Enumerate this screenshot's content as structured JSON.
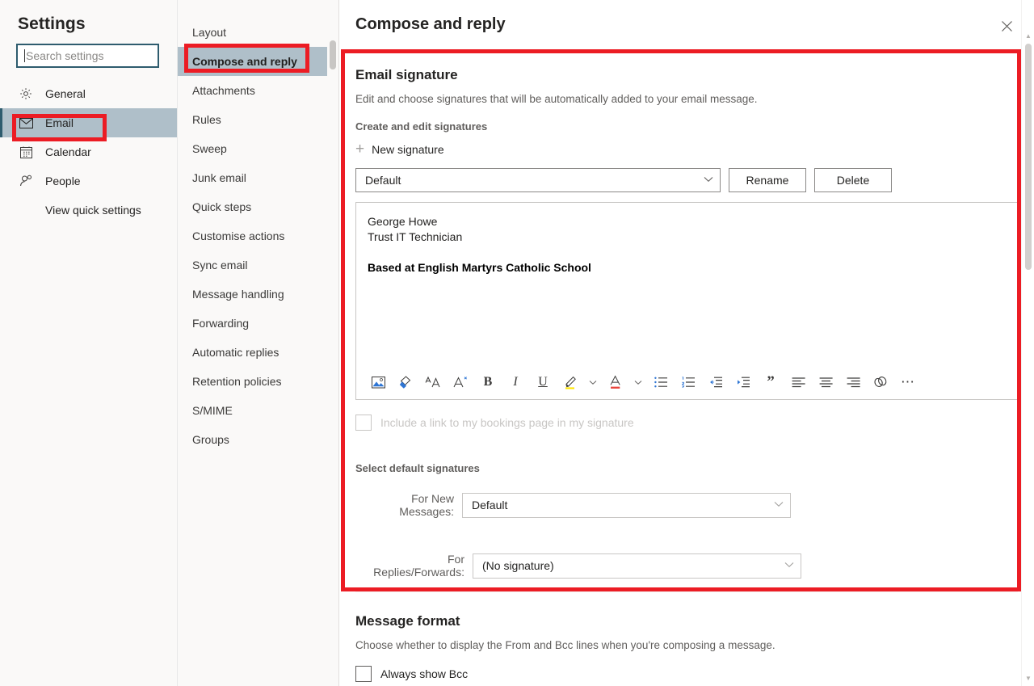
{
  "sidebar": {
    "title": "Settings",
    "search": {
      "placeholder": "Search settings",
      "value": ""
    },
    "items": [
      {
        "label": "General",
        "icon": "gear-icon"
      },
      {
        "label": "Email",
        "icon": "envelope-icon"
      },
      {
        "label": "Calendar",
        "icon": "calendar-icon"
      },
      {
        "label": "People",
        "icon": "person-icon"
      }
    ],
    "quick_settings_link": "View quick settings"
  },
  "midcol": {
    "items": [
      "Layout",
      "Compose and reply",
      "Attachments",
      "Rules",
      "Sweep",
      "Junk email",
      "Quick steps",
      "Customise actions",
      "Sync email",
      "Message handling",
      "Forwarding",
      "Automatic replies",
      "Retention policies",
      "S/MIME",
      "Groups"
    ],
    "selected": "Compose and reply"
  },
  "main": {
    "title": "Compose and reply",
    "close_label": "✕",
    "signature": {
      "heading": "Email signature",
      "description": "Edit and choose signatures that will be automatically added to your email message.",
      "create_label": "Create and edit signatures",
      "new_signature_label": "New signature",
      "selected_signature": "Default",
      "rename_label": "Rename",
      "delete_label": "Delete",
      "body_line1": "George Howe",
      "body_line2": "Trust IT Technician",
      "body_line3": "Based at English Martyrs Catholic School",
      "bookings_checkbox_label": "Include a link to my bookings page in my signature",
      "bookings_checked": false
    },
    "toolbar": [
      {
        "name": "insert-picture-icon",
        "title": "Insert picture"
      },
      {
        "name": "format-painter-icon",
        "title": "Format painter"
      },
      {
        "name": "font-size-icon",
        "title": "Font size"
      },
      {
        "name": "clear-formatting-icon",
        "title": "Clear formatting"
      },
      {
        "name": "bold-icon",
        "title": "Bold",
        "glyph": "B"
      },
      {
        "name": "italic-icon",
        "title": "Italic",
        "glyph": "I"
      },
      {
        "name": "underline-icon",
        "title": "Underline",
        "glyph": "U"
      },
      {
        "name": "highlight-icon",
        "title": "Highlight"
      },
      {
        "name": "highlight-chevron-icon",
        "title": "Highlight options"
      },
      {
        "name": "font-color-icon",
        "title": "Font colour"
      },
      {
        "name": "font-color-chevron-icon",
        "title": "Font colour options"
      },
      {
        "name": "bulleted-list-icon",
        "title": "Bulleted list"
      },
      {
        "name": "numbered-list-icon",
        "title": "Numbered list"
      },
      {
        "name": "decrease-indent-icon",
        "title": "Decrease indent"
      },
      {
        "name": "increase-indent-icon",
        "title": "Increase indent"
      },
      {
        "name": "quote-icon",
        "title": "Quote"
      },
      {
        "name": "align-left-icon",
        "title": "Align left"
      },
      {
        "name": "align-center-icon",
        "title": "Align centre"
      },
      {
        "name": "align-right-icon",
        "title": "Align right"
      },
      {
        "name": "insert-link-icon",
        "title": "Insert link"
      },
      {
        "name": "more-options-icon",
        "title": "More options"
      }
    ],
    "defaults": {
      "heading": "Select default signatures",
      "new_messages_label": "For New Messages:",
      "new_messages_value": "Default",
      "replies_label": "For Replies/Forwards:",
      "replies_value": "(No signature)"
    },
    "message_format": {
      "heading": "Message format",
      "description": "Choose whether to display the From and Bcc lines when you're composing a message.",
      "bcc_label": "Always show Bcc",
      "bcc_checked": false
    }
  },
  "annotations": {
    "color": "#ec1c24",
    "boxes": [
      "email-sidebar-item",
      "compose-and-reply-nav-item",
      "email-signature-section"
    ]
  }
}
